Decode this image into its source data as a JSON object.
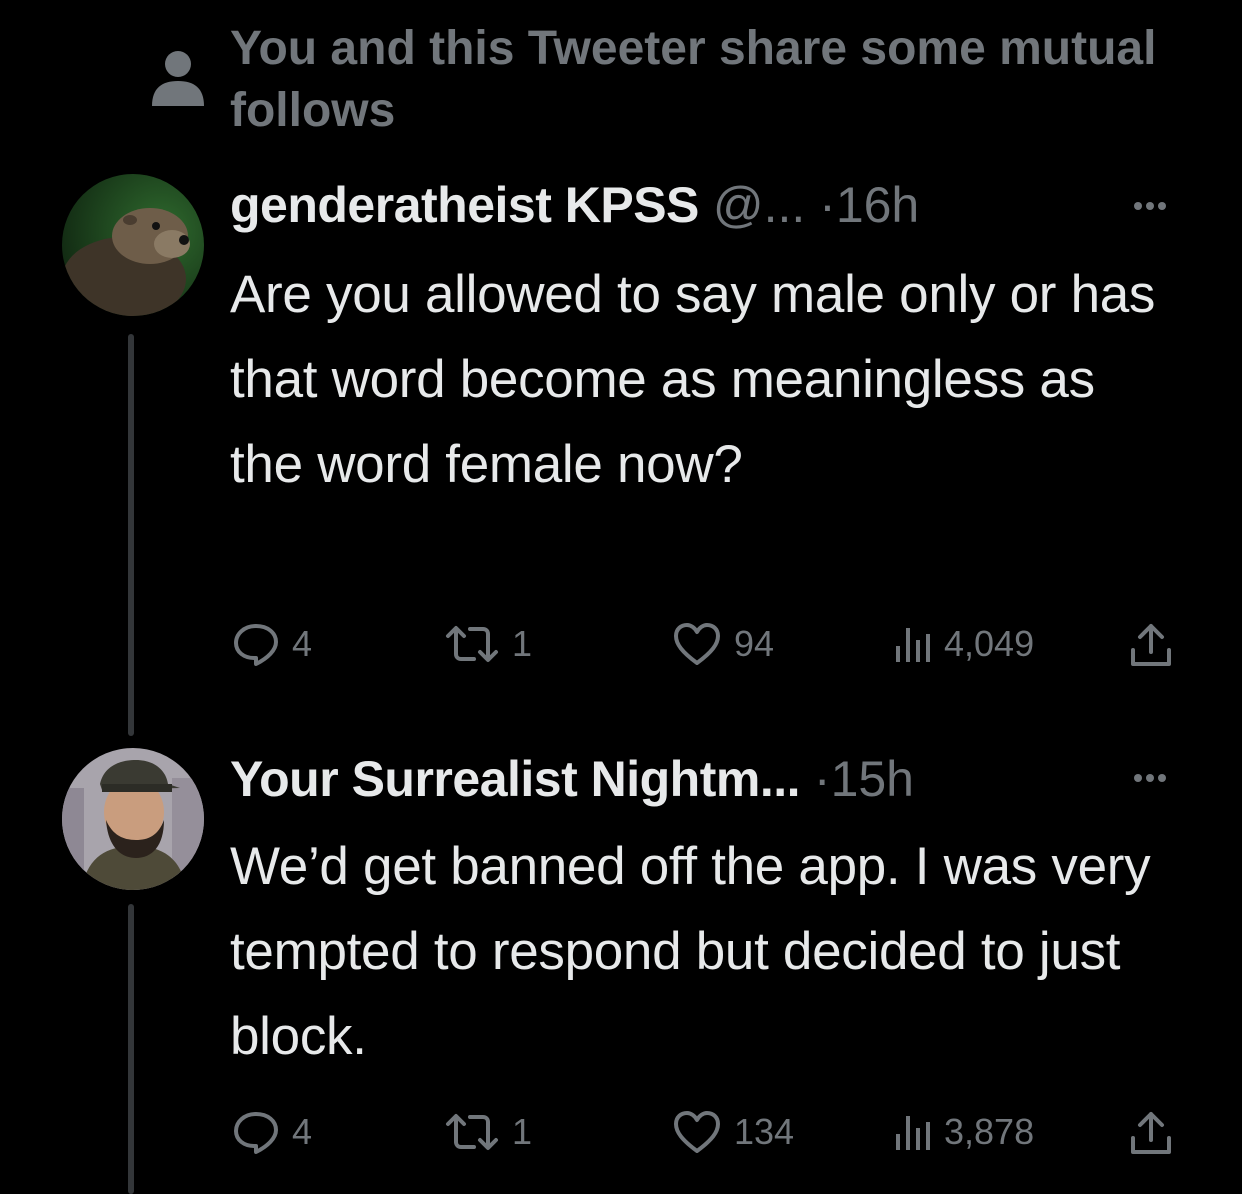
{
  "social_context": {
    "text": "You and this Tweeter share some mutual follows",
    "icon": "person-icon"
  },
  "tweets": [
    {
      "author_name": "genderatheist KPSS",
      "handle": "@...",
      "separator": "·",
      "time": "16h",
      "avatar": "otter-avatar",
      "text": "Are you allowed to say male only or has that word become as meaningless as the word female now?",
      "replies": "4",
      "retweets": "1",
      "likes": "94",
      "views": "4,049"
    },
    {
      "author_name": "Your Surrealist Nightm...",
      "separator": "·",
      "time": "15h",
      "avatar": "bearded-man-avatar",
      "text": "We’d get banned off the app. I was very tempted to respond but decided to just block.",
      "replies": "4",
      "retweets": "1",
      "likes": "134",
      "views": "3,878"
    }
  ],
  "colors": {
    "background": "#000000",
    "text": "#e7e9ea",
    "muted": "#71767b",
    "thread_line": "#333639"
  }
}
